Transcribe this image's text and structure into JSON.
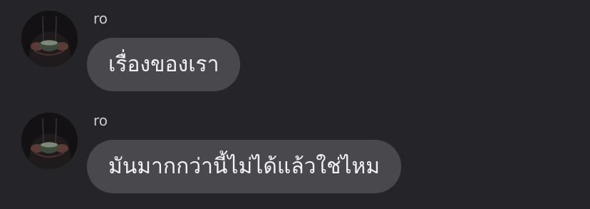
{
  "messages": [
    {
      "sender": "ro",
      "text": "เรื่องของเรา",
      "avatar_icon": "profile-photo-hands-holding-cup"
    },
    {
      "sender": "ro",
      "text": "มันมากกว่านี้ไม่ได้แล้วใช่ไหม",
      "avatar_icon": "profile-photo-hands-holding-cup"
    }
  ],
  "colors": {
    "background": "#242429",
    "bubble": "#48484d",
    "bubble_text": "#f2f2f4",
    "sender_text": "#c9c9ce"
  }
}
